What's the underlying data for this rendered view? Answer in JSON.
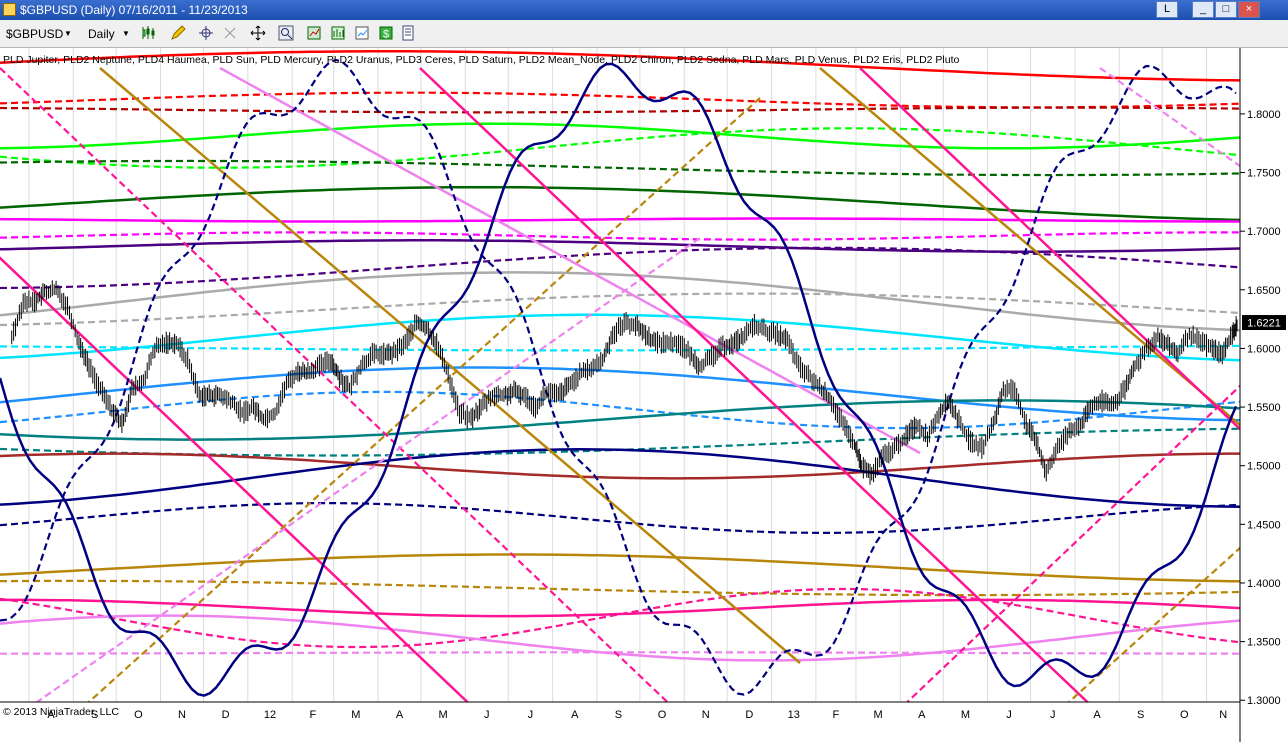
{
  "window": {
    "title": "$GBPUSD (Daily)  07/16/2011 - 11/23/2013",
    "buttons": [
      "L",
      "_",
      "□",
      "×"
    ]
  },
  "toolbar": {
    "instrument": "$GBPUSD",
    "period": "Daily"
  },
  "chart_data": {
    "type": "line",
    "instrument": "$GBPUSD",
    "period": "Daily",
    "date_range": [
      "07/16/2011",
      "11/23/2013"
    ],
    "indicator_legend": "PLD Jupiter, PLD2 Neptune, PLD4 Haumea, PLD Sun, PLD Mercury, PLD2 Uranus, PLD3 Ceres, PLD Saturn, PLD2 Mean_Node, PLD2 Chiron, PLD2 Sedna, PLD Mars, PLD Venus, PLD2 Eris, PLD2 Pluto",
    "copyright": "© 2013 NinjaTrader, LLC",
    "y_axis": {
      "ticks": [
        "1.8000",
        "1.7500",
        "1.7000",
        "1.6500",
        "1.6000",
        "1.5500",
        "1.5000",
        "1.4500",
        "1.4000",
        "1.3500",
        "1.3000"
      ],
      "range": [
        1.2985,
        1.8562
      ]
    },
    "last_price": "1.6221",
    "x_labels": [
      "A",
      "S",
      "O",
      "N",
      "D",
      "12",
      "F",
      "M",
      "A",
      "M",
      "J",
      "J",
      "A",
      "S",
      "O",
      "N",
      "D",
      "13",
      "F",
      "M",
      "A",
      "M",
      "J",
      "J",
      "A",
      "S",
      "O",
      "N"
    ],
    "price_series": {
      "name": "$GBPUSD",
      "points": [
        [
          "2011-07-20",
          1.61
        ],
        [
          "2011-07-28",
          1.64
        ],
        [
          "2011-08-05",
          1.64
        ],
        [
          "2011-08-12",
          1.648
        ],
        [
          "2011-08-20",
          1.65
        ],
        [
          "2011-08-28",
          1.636
        ],
        [
          "2011-09-05",
          1.605
        ],
        [
          "2011-09-12",
          1.585
        ],
        [
          "2011-09-20",
          1.565
        ],
        [
          "2011-09-28",
          1.548
        ],
        [
          "2011-10-05",
          1.535
        ],
        [
          "2011-10-12",
          1.565
        ],
        [
          "2011-10-20",
          1.572
        ],
        [
          "2011-10-28",
          1.6
        ],
        [
          "2011-11-05",
          1.605
        ],
        [
          "2011-11-12",
          1.605
        ],
        [
          "2011-11-20",
          1.59
        ],
        [
          "2011-11-28",
          1.56
        ],
        [
          "2011-12-05",
          1.56
        ],
        [
          "2011-12-12",
          1.56
        ],
        [
          "2011-12-20",
          1.555
        ],
        [
          "2011-12-28",
          1.545
        ],
        [
          "2012-01-05",
          1.55
        ],
        [
          "2012-01-12",
          1.54
        ],
        [
          "2012-01-20",
          1.545
        ],
        [
          "2012-01-28",
          1.57
        ],
        [
          "2012-02-05",
          1.58
        ],
        [
          "2012-02-12",
          1.58
        ],
        [
          "2012-02-20",
          1.585
        ],
        [
          "2012-02-28",
          1.59
        ],
        [
          "2012-03-05",
          1.576
        ],
        [
          "2012-03-12",
          1.566
        ],
        [
          "2012-03-20",
          1.585
        ],
        [
          "2012-03-28",
          1.595
        ],
        [
          "2012-04-05",
          1.595
        ],
        [
          "2012-04-12",
          1.596
        ],
        [
          "2012-04-20",
          1.605
        ],
        [
          "2012-04-28",
          1.622
        ],
        [
          "2012-05-05",
          1.617
        ],
        [
          "2012-05-12",
          1.604
        ],
        [
          "2012-05-20",
          1.578
        ],
        [
          "2012-05-28",
          1.545
        ],
        [
          "2012-06-05",
          1.54
        ],
        [
          "2012-06-12",
          1.55
        ],
        [
          "2012-06-20",
          1.56
        ],
        [
          "2012-06-28",
          1.56
        ],
        [
          "2012-07-05",
          1.563
        ],
        [
          "2012-07-12",
          1.56
        ],
        [
          "2012-07-20",
          1.55
        ],
        [
          "2012-07-28",
          1.563
        ],
        [
          "2012-08-05",
          1.56
        ],
        [
          "2012-08-12",
          1.568
        ],
        [
          "2012-08-20",
          1.578
        ],
        [
          "2012-08-28",
          1.583
        ],
        [
          "2012-09-05",
          1.59
        ],
        [
          "2012-09-12",
          1.612
        ],
        [
          "2012-09-20",
          1.622
        ],
        [
          "2012-09-28",
          1.62
        ],
        [
          "2012-10-05",
          1.612
        ],
        [
          "2012-10-12",
          1.605
        ],
        [
          "2012-10-20",
          1.605
        ],
        [
          "2012-10-28",
          1.605
        ],
        [
          "2012-11-05",
          1.595
        ],
        [
          "2012-11-12",
          1.585
        ],
        [
          "2012-11-20",
          1.592
        ],
        [
          "2012-11-28",
          1.602
        ],
        [
          "2012-12-05",
          1.604
        ],
        [
          "2012-12-12",
          1.61
        ],
        [
          "2012-12-20",
          1.62
        ],
        [
          "2012-12-28",
          1.615
        ],
        [
          "2013-01-05",
          1.612
        ],
        [
          "2013-01-12",
          1.607
        ],
        [
          "2013-01-20",
          1.585
        ],
        [
          "2013-01-28",
          1.575
        ],
        [
          "2013-02-05",
          1.565
        ],
        [
          "2013-02-12",
          1.555
        ],
        [
          "2013-02-20",
          1.535
        ],
        [
          "2013-02-28",
          1.518
        ],
        [
          "2013-03-05",
          1.5
        ],
        [
          "2013-03-12",
          1.492
        ],
        [
          "2013-03-20",
          1.508
        ],
        [
          "2013-03-28",
          1.515
        ],
        [
          "2013-04-05",
          1.525
        ],
        [
          "2013-04-12",
          1.535
        ],
        [
          "2013-04-20",
          1.525
        ],
        [
          "2013-04-28",
          1.545
        ],
        [
          "2013-05-05",
          1.555
        ],
        [
          "2013-05-12",
          1.538
        ],
        [
          "2013-05-20",
          1.52
        ],
        [
          "2013-05-28",
          1.515
        ],
        [
          "2013-06-05",
          1.535
        ],
        [
          "2013-06-12",
          1.565
        ],
        [
          "2013-06-20",
          1.565
        ],
        [
          "2013-06-28",
          1.535
        ],
        [
          "2013-07-05",
          1.52
        ],
        [
          "2013-07-12",
          1.495
        ],
        [
          "2013-07-20",
          1.515
        ],
        [
          "2013-07-28",
          1.53
        ],
        [
          "2013-08-05",
          1.535
        ],
        [
          "2013-08-12",
          1.55
        ],
        [
          "2013-08-20",
          1.555
        ],
        [
          "2013-08-28",
          1.552
        ],
        [
          "2013-09-05",
          1.565
        ],
        [
          "2013-09-12",
          1.585
        ],
        [
          "2013-09-20",
          1.6
        ],
        [
          "2013-09-28",
          1.61
        ],
        [
          "2013-10-05",
          1.602
        ],
        [
          "2013-10-12",
          1.595
        ],
        [
          "2013-10-20",
          1.612
        ],
        [
          "2013-10-28",
          1.605
        ],
        [
          "2013-11-05",
          1.6
        ],
        [
          "2013-11-12",
          1.595
        ],
        [
          "2013-11-19",
          1.612
        ],
        [
          "2013-11-23",
          1.6221
        ]
      ]
    },
    "grid": "vertical lines at month boundaries"
  },
  "overlay_styles": [
    {
      "color": "#ff0000",
      "dash": false,
      "width": 2.5
    },
    {
      "color": "#ff0000",
      "dash": true,
      "width": 2.2
    },
    {
      "color": "#b00000",
      "dash": true,
      "width": 2.2
    },
    {
      "color": "#00ff00",
      "dash": false,
      "width": 2.5
    },
    {
      "color": "#00ff00",
      "dash": true,
      "width": 2.2
    },
    {
      "color": "#006400",
      "dash": true,
      "width": 2.2
    },
    {
      "color": "#006400",
      "dash": false,
      "width": 2.5
    },
    {
      "color": "#ff00ff",
      "dash": false,
      "width": 2.5
    },
    {
      "color": "#ff00ff",
      "dash": true,
      "width": 2.2
    },
    {
      "color": "#4b0082",
      "dash": false,
      "width": 2.5
    },
    {
      "color": "#4b0082",
      "dash": true,
      "width": 2.2
    },
    {
      "color": "#aaaaaa",
      "dash": false,
      "width": 2.5
    },
    {
      "color": "#aaaaaa",
      "dash": true,
      "width": 2.2
    },
    {
      "color": "#00e5ff",
      "dash": false,
      "width": 2.5
    },
    {
      "color": "#00e5ff",
      "dash": true,
      "width": 2.2
    },
    {
      "color": "#1e90ff",
      "dash": false,
      "width": 2.5
    },
    {
      "color": "#1e90ff",
      "dash": true,
      "width": 2.2
    },
    {
      "color": "#008080",
      "dash": false,
      "width": 2.5
    },
    {
      "color": "#008080",
      "dash": true,
      "width": 2.2
    },
    {
      "color": "#a52a2a",
      "dash": false,
      "width": 2.5
    },
    {
      "color": "#000080",
      "dash": false,
      "width": 2.5
    },
    {
      "color": "#000080",
      "dash": true,
      "width": 2.2
    },
    {
      "color": "#b8860b",
      "dash": false,
      "width": 2.5
    },
    {
      "color": "#b8860b",
      "dash": true,
      "width": 2.2
    },
    {
      "color": "#ff1493",
      "dash": false,
      "width": 2.5
    },
    {
      "color": "#ff1493",
      "dash": true,
      "width": 2.2
    },
    {
      "color": "#ee82ee",
      "dash": false,
      "width": 2.5
    },
    {
      "color": "#ee82ee",
      "dash": true,
      "width": 2.2
    }
  ],
  "colors": {
    "price_bars": "#000000",
    "last_price_box": "#000000",
    "grid": "#dcdcdc"
  }
}
